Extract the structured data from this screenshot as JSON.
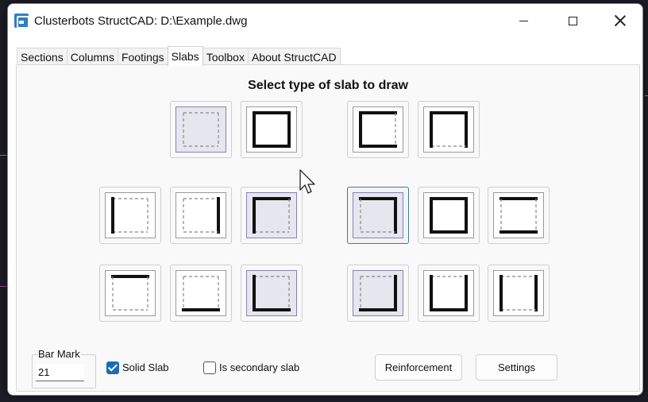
{
  "window": {
    "title": "Clusterbots StructCAD:  D:\\Example.dwg"
  },
  "tabs": [
    {
      "label": "Sections",
      "active": false
    },
    {
      "label": "Columns",
      "active": false
    },
    {
      "label": "Footings",
      "active": false
    },
    {
      "label": "Slabs",
      "active": true
    },
    {
      "label": "Toolbox",
      "active": false
    },
    {
      "label": "About StructCAD",
      "active": false
    }
  ],
  "slabs_panel": {
    "heading": "Select type of slab to draw",
    "slab_types": [
      {
        "name": "all-edges-dashed",
        "edges": {
          "top": "dashed",
          "right": "dashed",
          "bottom": "dashed",
          "left": "dashed"
        },
        "tint": true,
        "selected": false
      },
      {
        "name": "all-edges-thick",
        "edges": {
          "top": "thick",
          "right": "thick",
          "bottom": "thick",
          "left": "thick"
        },
        "tint": false,
        "selected": false
      },
      {
        "name": "left-top-bottom-thick",
        "edges": {
          "top": "thick",
          "right": "dashed",
          "bottom": "thick",
          "left": "thick"
        },
        "tint": false,
        "selected": false
      },
      {
        "name": "left-top-right-thick",
        "edges": {
          "top": "thick",
          "right": "thick",
          "bottom": "dashed",
          "left": "thick"
        },
        "tint": false,
        "selected": false
      },
      {
        "name": "left-thick",
        "edges": {
          "top": "dashed",
          "right": "dashed",
          "bottom": "dashed",
          "left": "thick"
        },
        "tint": false,
        "selected": false
      },
      {
        "name": "right-thick",
        "edges": {
          "top": "dashed",
          "right": "thick",
          "bottom": "dashed",
          "left": "dashed"
        },
        "tint": false,
        "selected": false
      },
      {
        "name": "left-top-thick",
        "edges": {
          "top": "thick",
          "right": "dashed",
          "bottom": "dashed",
          "left": "thick"
        },
        "tint": true,
        "selected": false
      },
      {
        "name": "top-right-thick",
        "edges": {
          "top": "thick",
          "right": "thick",
          "bottom": "dashed",
          "left": "dashed"
        },
        "tint": true,
        "selected": true
      },
      {
        "name": "three-sides-thick-right-dashed",
        "edges": {
          "top": "thick",
          "right": "thick",
          "bottom": "thick",
          "left": "thick"
        },
        "tint": false,
        "selected": false
      },
      {
        "name": "top-bottom-thick",
        "edges": {
          "top": "thick",
          "right": "dashed",
          "bottom": "thick",
          "left": "dashed"
        },
        "tint": false,
        "selected": false
      },
      {
        "name": "top-thick",
        "edges": {
          "top": "thick",
          "right": "dashed",
          "bottom": "dashed",
          "left": "dashed"
        },
        "tint": false,
        "selected": false
      },
      {
        "name": "bottom-thick",
        "edges": {
          "top": "dashed",
          "right": "dashed",
          "bottom": "thick",
          "left": "dashed"
        },
        "tint": false,
        "selected": false
      },
      {
        "name": "left-bottom-thick",
        "edges": {
          "top": "dashed",
          "right": "dashed",
          "bottom": "thick",
          "left": "thick"
        },
        "tint": true,
        "selected": false
      },
      {
        "name": "bottom-right-thick",
        "edges": {
          "top": "dashed",
          "right": "thick",
          "bottom": "thick",
          "left": "dashed"
        },
        "tint": true,
        "selected": false
      },
      {
        "name": "left-bottom-right-thick",
        "edges": {
          "top": "dashed",
          "right": "thick",
          "bottom": "thick",
          "left": "thick"
        },
        "tint": false,
        "selected": false
      },
      {
        "name": "left-right-thick",
        "edges": {
          "top": "dashed",
          "right": "thick",
          "bottom": "dashed",
          "left": "thick"
        },
        "tint": false,
        "selected": false
      }
    ],
    "bar_mark": {
      "label": "Bar Mark",
      "value": "21"
    },
    "solid_slab": {
      "label": "Solid Slab",
      "checked": true
    },
    "secondary_slab": {
      "label": "Is secondary slab",
      "checked": false
    },
    "reinforcement_button": "Reinforcement",
    "settings_button": "Settings"
  },
  "colors": {
    "accent": "#1f6ab2",
    "selected_border": "#4a7a8a",
    "tint": "#e6e6ee",
    "tint_border": "#8a7fb8"
  }
}
